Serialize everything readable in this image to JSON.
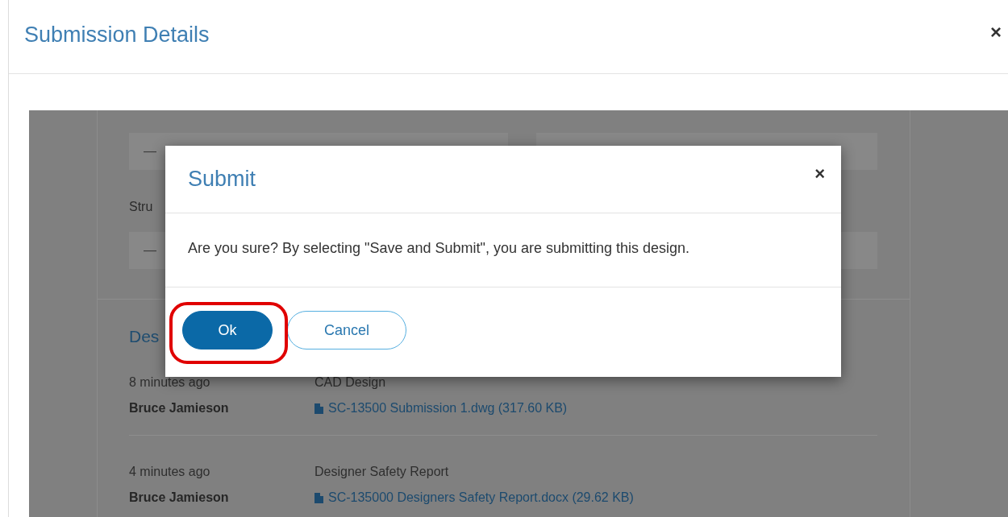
{
  "modal": {
    "title": "Submission Details",
    "close": "×"
  },
  "fields": [
    {
      "value": "—"
    },
    {
      "label": "Stru",
      "value": "—"
    }
  ],
  "section_heading": "Des",
  "history": [
    {
      "time": "8 minutes ago",
      "user": "Bruce Jamieson",
      "document": "CAD Design",
      "file": "SC-13500 Submission 1.dwg (317.60 KB)"
    },
    {
      "time": "4 minutes ago",
      "user": "Bruce Jamieson",
      "document": "Designer Safety Report",
      "file": "SC-135000 Designers Safety Report.docx (29.62 KB)"
    }
  ],
  "dialog": {
    "title": "Submit",
    "close": "×",
    "message": "Are you sure? By selecting \"Save and Submit\", you are submitting this design.",
    "buttons": [
      {
        "label": "Ok",
        "kind": "primary"
      },
      {
        "label": "Cancel",
        "kind": "secondary"
      }
    ]
  }
}
